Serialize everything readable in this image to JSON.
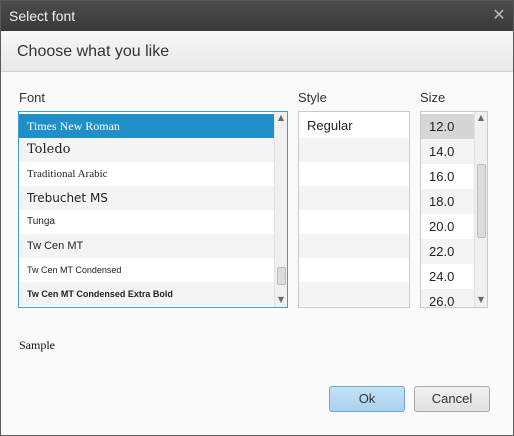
{
  "window": {
    "title": "Select font"
  },
  "header": {
    "text": "Choose what you like"
  },
  "labels": {
    "font": "Font",
    "style": "Style",
    "size": "Size"
  },
  "font_list": [
    "Times New Roman",
    "Toledo",
    "Traditional Arabic",
    "Trebuchet MS",
    "Tunga",
    "Tw Cen MT",
    "Tw Cen MT Condensed",
    "Tw Cen MT Condensed Extra Bold"
  ],
  "font_selected": "Times New Roman",
  "style_list": [
    "Regular"
  ],
  "size_list": [
    "12.0",
    "14.0",
    "16.0",
    "18.0",
    "20.0",
    "22.0",
    "24.0",
    "26.0"
  ],
  "size_selected": "12.0",
  "sample": {
    "label": "Sample"
  },
  "buttons": {
    "ok": "Ok",
    "cancel": "Cancel"
  },
  "colors": {
    "titlebar": "#3f3f3f",
    "selection_blue": "#1e8fc7",
    "ok_button": "#b7daf2"
  },
  "icons": {
    "close": "close-icon"
  }
}
